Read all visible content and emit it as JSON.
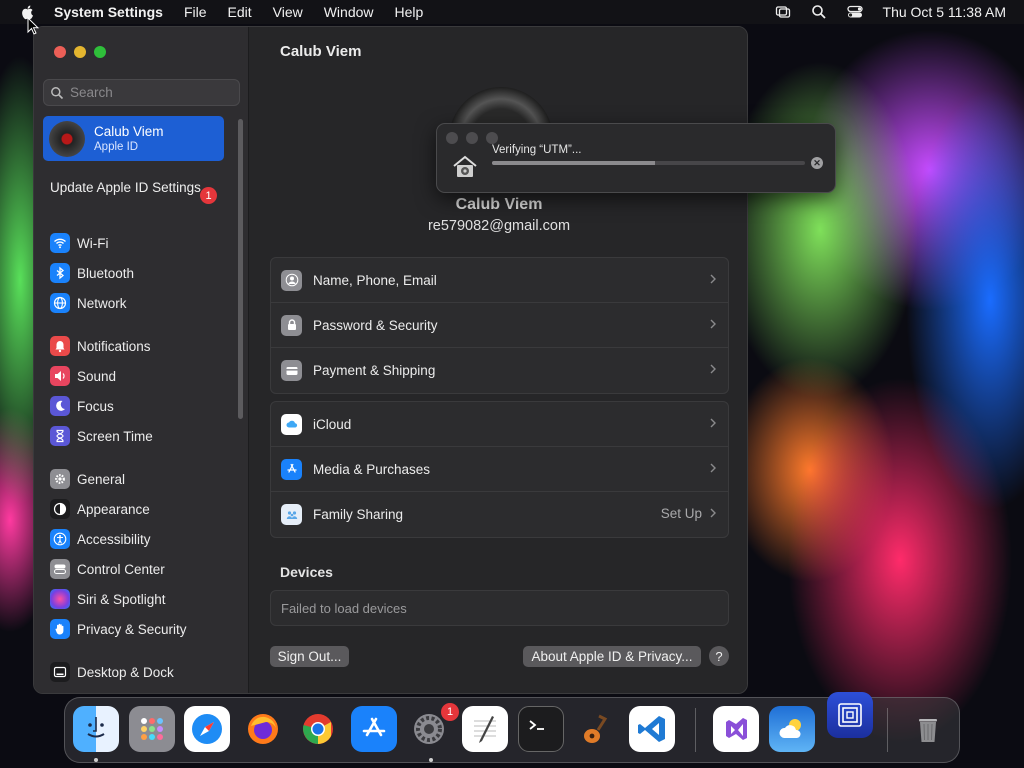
{
  "menubar": {
    "app_name": "System Settings",
    "items": [
      "File",
      "Edit",
      "View",
      "Window",
      "Help"
    ],
    "clock": "Thu Oct 5  11:38 AM"
  },
  "sidebar": {
    "search_placeholder": "Search",
    "profile": {
      "name": "Calub Viem",
      "subtitle": "Apple ID"
    },
    "update": {
      "label": "Update Apple ID Settings",
      "badge": "1"
    },
    "items": [
      {
        "label": "Wi-Fi",
        "icon": "wifi-icon",
        "color": "#1a82fb"
      },
      {
        "label": "Bluetooth",
        "icon": "bluetooth-icon",
        "color": "#1a82fb"
      },
      {
        "label": "Network",
        "icon": "globe-icon",
        "color": "#1a82fb"
      },
      {
        "label": "Notifications",
        "icon": "bell-icon",
        "color": "#ea4a4a"
      },
      {
        "label": "Sound",
        "icon": "speaker-icon",
        "color": "#e8455f"
      },
      {
        "label": "Focus",
        "icon": "moon-icon",
        "color": "#5b57d6"
      },
      {
        "label": "Screen Time",
        "icon": "hourglass-icon",
        "color": "#5b57d6"
      },
      {
        "label": "General",
        "icon": "gear-icon",
        "color": "#8e8e93"
      },
      {
        "label": "Appearance",
        "icon": "appearance-icon",
        "color": "#1c1c1e"
      },
      {
        "label": "Accessibility",
        "icon": "accessibility-icon",
        "color": "#1a82fb"
      },
      {
        "label": "Control Center",
        "icon": "toggles-icon",
        "color": "#8e8e93"
      },
      {
        "label": "Siri & Spotlight",
        "icon": "siri-icon",
        "color": "#7a3fe0"
      },
      {
        "label": "Privacy & Security",
        "icon": "hand-icon",
        "color": "#1a82fb"
      },
      {
        "label": "Desktop & Dock",
        "icon": "dock-icon",
        "color": "#1c1c1e"
      }
    ]
  },
  "main": {
    "title": "Calub Viem",
    "user_name": "Calub Viem",
    "user_email": "re579082@gmail.com",
    "group1": [
      {
        "label": "Name, Phone, Email",
        "icon": "person-icon",
        "color": "#8e8e93"
      },
      {
        "label": "Password & Security",
        "icon": "lock-icon",
        "color": "#8e8e93"
      },
      {
        "label": "Payment & Shipping",
        "icon": "card-icon",
        "color": "#8e8e93"
      }
    ],
    "group2": [
      {
        "label": "iCloud",
        "icon": "cloud-icon",
        "color": "#ffffff",
        "trail": ""
      },
      {
        "label": "Media & Purchases",
        "icon": "appstore-icon",
        "color": "#1a82fb",
        "trail": ""
      },
      {
        "label": "Family Sharing",
        "icon": "family-icon",
        "color": "#e6eef8",
        "trail": "Set Up"
      }
    ],
    "devices_heading": "Devices",
    "devices_message": "Failed to load devices",
    "sign_out": "Sign Out...",
    "about": "About Apple ID & Privacy...",
    "help": "?"
  },
  "popup": {
    "text": "Verifying “UTM”...",
    "progress": 0.52
  },
  "dock": {
    "settings_badge": "1",
    "apps": [
      "finder-icon",
      "launchpad-icon",
      "safari-icon",
      "firefox-icon",
      "chrome-icon",
      "appstore-icon",
      "system-settings-icon",
      "textedit-icon",
      "terminal-icon",
      "garageband-icon",
      "vscode-icon",
      "visual-studio-icon",
      "weather-icon",
      "utm-icon",
      "trash-icon"
    ]
  }
}
